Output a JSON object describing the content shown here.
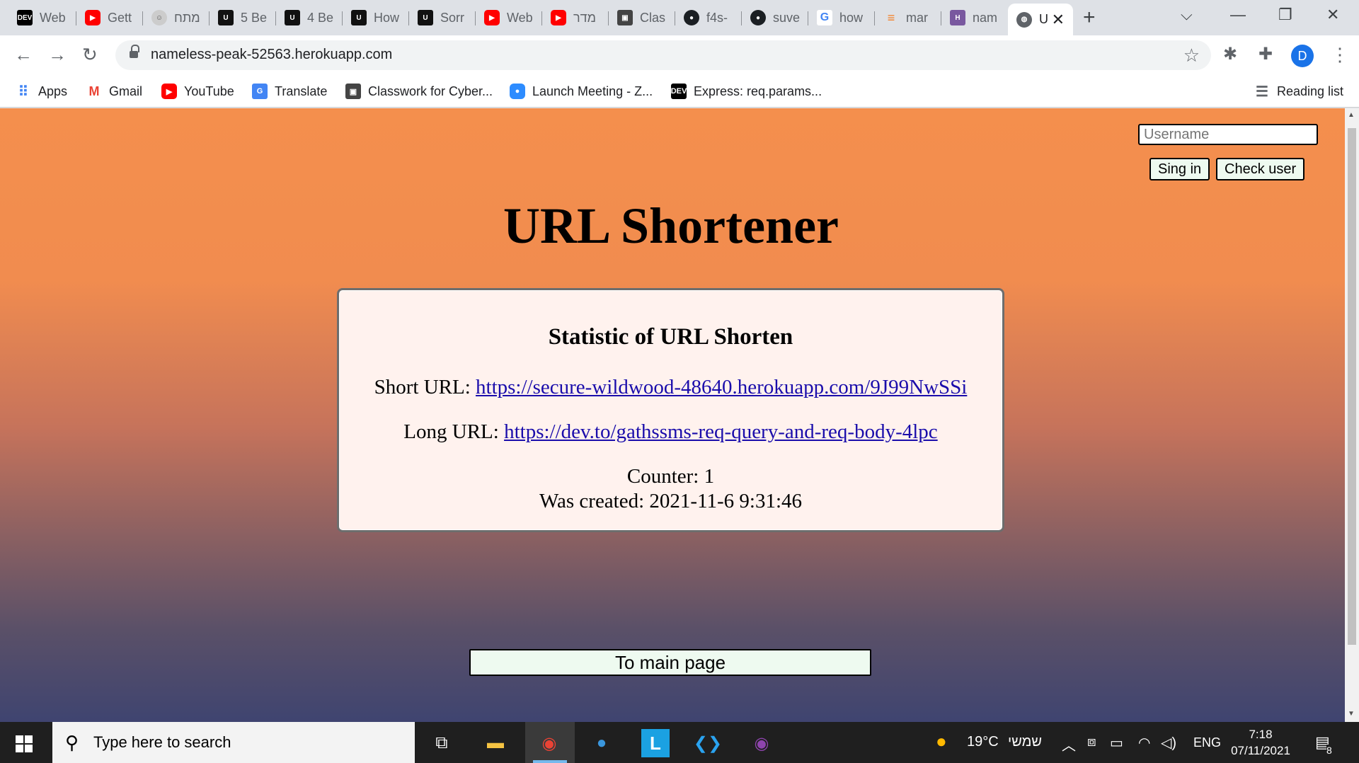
{
  "browser": {
    "tabs": [
      {
        "favicon": "DEV",
        "title": "Web"
      },
      {
        "favicon": "youtube",
        "title": "Gett"
      },
      {
        "favicon": "face",
        "title": "מתח"
      },
      {
        "favicon": "U",
        "title": "5 Be"
      },
      {
        "favicon": "U",
        "title": "4 Be"
      },
      {
        "favicon": "U",
        "title": "How"
      },
      {
        "favicon": "U",
        "title": "Sorr"
      },
      {
        "favicon": "youtube",
        "title": "Web"
      },
      {
        "favicon": "youtube",
        "title": "מדר"
      },
      {
        "favicon": "classroom",
        "title": "Clas"
      },
      {
        "favicon": "github",
        "title": "f4s-"
      },
      {
        "favicon": "github",
        "title": "suve"
      },
      {
        "favicon": "google",
        "title": "how"
      },
      {
        "favicon": "stackoverflow",
        "title": "mar"
      },
      {
        "favicon": "heroku",
        "title": "nam"
      },
      {
        "favicon": "globe",
        "title": "U",
        "active": true
      }
    ],
    "url": "nameless-peak-52563.herokuapp.com",
    "profile_initial": "D",
    "bookmarks": [
      {
        "icon": "apps",
        "label": "Apps"
      },
      {
        "icon": "gmail",
        "label": "Gmail"
      },
      {
        "icon": "youtube",
        "label": "YouTube"
      },
      {
        "icon": "translate",
        "label": "Translate"
      },
      {
        "icon": "classroom",
        "label": "Classwork for Cyber..."
      },
      {
        "icon": "zoom",
        "label": "Launch Meeting - Z..."
      },
      {
        "icon": "DEV",
        "label": "Express: req.params..."
      }
    ],
    "reading_list": "Reading list"
  },
  "page": {
    "username_placeholder": "Username",
    "signin_label": "Sing in",
    "check_user_label": "Check user",
    "title": "URL Shortener",
    "stats": {
      "heading": "Statistic of URL Shorten",
      "short_label": "Short URL:",
      "short_url": "https://secure-wildwood-48640.herokuapp.com/9J99NwSSi",
      "long_label": "Long URL:",
      "long_url": "https://dev.to/gathssms-req-query-and-req-body-4lpc",
      "counter_label": "Counter:",
      "counter": "1",
      "created_label": "Was created:",
      "created": "2021-11-6 9:31:46"
    },
    "main_page_label": "To main page"
  },
  "taskbar": {
    "search_placeholder": "Type here to search",
    "weather": "19°C",
    "weather_day": "שמשי",
    "language": "ENG",
    "time": "7:18",
    "date": "07/11/2021",
    "notifications": "8"
  },
  "colors": {
    "gradient_top": "#f48f4d",
    "gradient_bottom": "#3f4470",
    "card_bg": "#fff2ee",
    "button_bg": "#eefaf0",
    "link": "#1a0dab"
  }
}
